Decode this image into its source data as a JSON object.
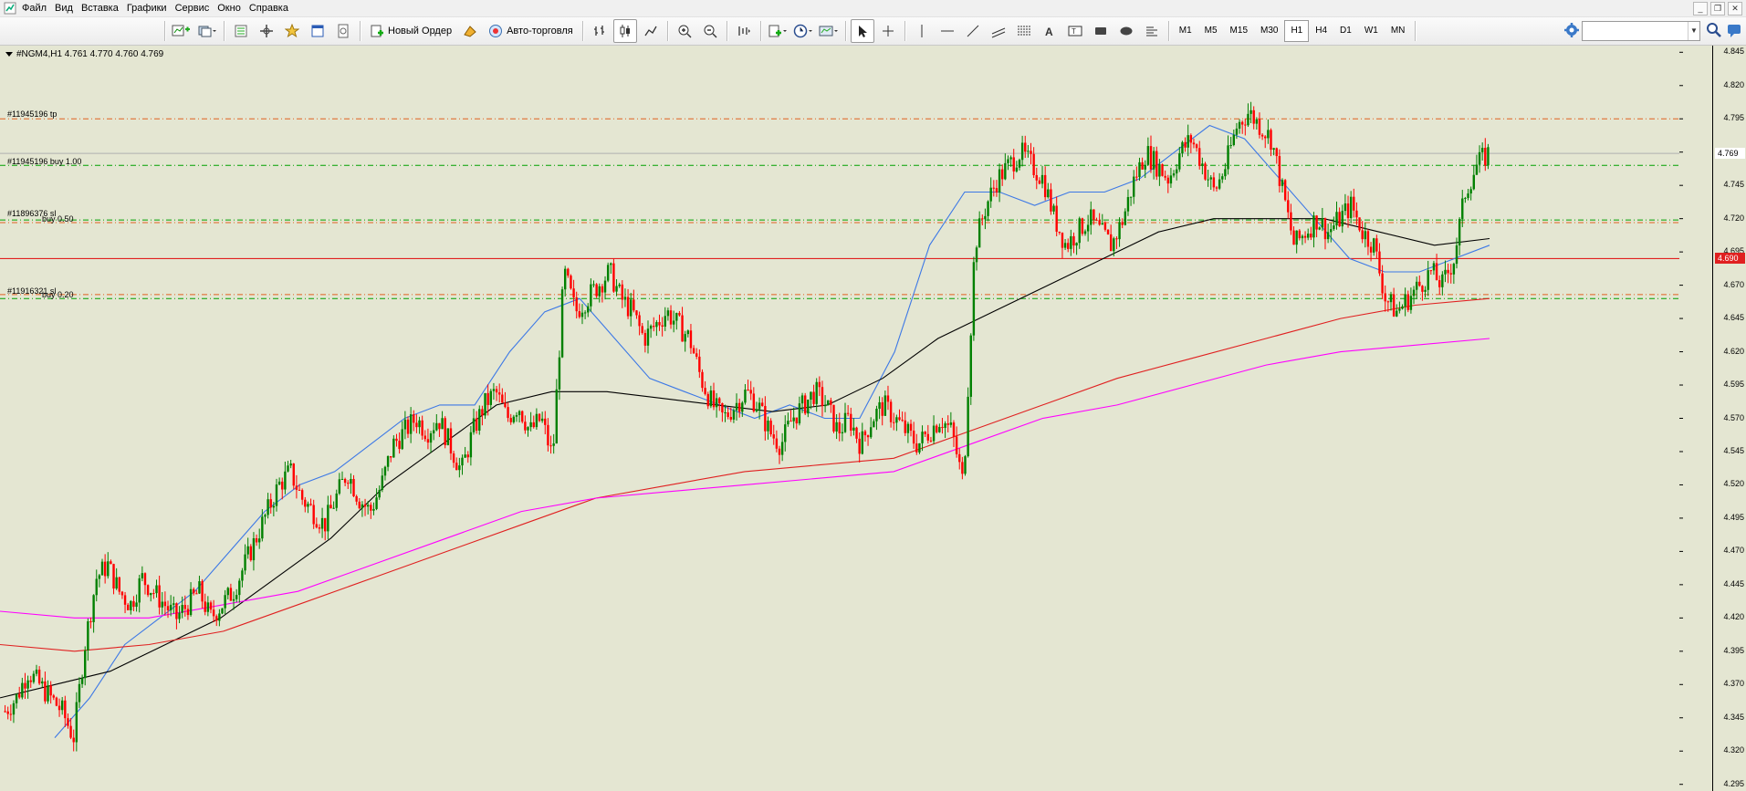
{
  "menu": {
    "items": [
      "Файл",
      "Вид",
      "Вставка",
      "Графики",
      "Сервис",
      "Окно",
      "Справка"
    ]
  },
  "toolbar": {
    "new_order": "Новый Ордер",
    "auto_trading": "Авто-торговля",
    "timeframes": [
      "M1",
      "M5",
      "M15",
      "M30",
      "H1",
      "H4",
      "D1",
      "W1",
      "MN"
    ],
    "active_timeframe": "H1",
    "search_placeholder": ""
  },
  "chart": {
    "header": "#NGM4,H1  4.761 4.770 4.760 4.769",
    "current_price": "4.769",
    "red_line_price": "4.690",
    "colors": {
      "background": "#e4e6d2",
      "bull": "#008000",
      "bear": "#ff0000",
      "ma_blue": "#3c78e6",
      "ma_black": "#000000",
      "ma_red": "#e02020",
      "ma_magenta": "#ff00ff"
    },
    "orders": [
      {
        "label": "#11945196 tp",
        "price": 4.795,
        "color": "#e06020"
      },
      {
        "label": "#11945196 buy 1.00",
        "price": 4.76,
        "color": "#00a000"
      },
      {
        "label": "#11896376 sl",
        "price": 4.717,
        "color": "#e06020"
      },
      {
        "label": "#11916321 sl",
        "price": 4.663,
        "color": "#e06020"
      },
      {
        "label": "buy 0.50",
        "price": 4.719,
        "color": "#00a000"
      },
      {
        "label": "buy 0.20",
        "price": 4.66,
        "color": "#00a000"
      }
    ],
    "price_ticks": [
      "4.845",
      "4.820",
      "4.795",
      "4.770",
      "4.745",
      "4.720",
      "4.695",
      "4.670",
      "4.645",
      "4.620",
      "4.595",
      "4.570",
      "4.545",
      "4.520",
      "4.495",
      "4.470",
      "4.445",
      "4.420",
      "4.395",
      "4.370",
      "4.345",
      "4.320",
      "4.295"
    ]
  },
  "chart_data": {
    "type": "candlestick",
    "symbol": "#NGM4",
    "timeframe": "H1",
    "ylim": [
      4.29,
      4.85
    ],
    "close_path": [
      4.35,
      4.36,
      4.38,
      4.37,
      4.36,
      4.35,
      4.33,
      4.4,
      4.45,
      4.46,
      4.44,
      4.43,
      4.45,
      4.44,
      4.43,
      4.42,
      4.43,
      4.44,
      4.42,
      4.43,
      4.44,
      4.46,
      4.48,
      4.5,
      4.52,
      4.53,
      4.51,
      4.5,
      4.49,
      4.51,
      4.53,
      4.51,
      4.5,
      4.52,
      4.55,
      4.56,
      4.57,
      4.56,
      4.57,
      4.55,
      4.53,
      4.56,
      4.58,
      4.59,
      4.57,
      4.58,
      4.56,
      4.57,
      4.54,
      4.68,
      4.65,
      4.66,
      4.67,
      4.68,
      4.66,
      4.65,
      4.63,
      4.64,
      4.65,
      4.64,
      4.63,
      4.6,
      4.58,
      4.57,
      4.58,
      4.59,
      4.58,
      4.56,
      4.55,
      4.57,
      4.58,
      4.59,
      4.58,
      4.56,
      4.57,
      4.55,
      4.57,
      4.58,
      4.57,
      4.56,
      4.55,
      4.56,
      4.57,
      4.56,
      4.52,
      4.7,
      4.73,
      4.75,
      4.76,
      4.77,
      4.76,
      4.75,
      4.72,
      4.7,
      4.71,
      4.72,
      4.71,
      4.7,
      4.72,
      4.75,
      4.77,
      4.76,
      4.75,
      4.77,
      4.78,
      4.76,
      4.74,
      4.76,
      4.79,
      4.8,
      4.79,
      4.78,
      4.74,
      4.7,
      4.71,
      4.72,
      4.71,
      4.72,
      4.73,
      4.71,
      4.7,
      4.66,
      4.65,
      4.66,
      4.67,
      4.68,
      4.67,
      4.69,
      4.74,
      4.76,
      4.769
    ],
    "moving_averages": [
      {
        "color": "blue",
        "values": [
          4.33,
          4.36,
          4.4,
          4.42,
          4.44,
          4.47,
          4.5,
          4.52,
          4.53,
          4.55,
          4.57,
          4.58,
          4.58,
          4.62,
          4.65,
          4.66,
          4.63,
          4.6,
          4.59,
          4.58,
          4.57,
          4.58,
          4.57,
          4.57,
          4.62,
          4.7,
          4.74,
          4.74,
          4.73,
          4.74,
          4.74,
          4.75,
          4.77,
          4.79,
          4.78,
          4.75,
          4.72,
          4.69,
          4.68,
          4.68,
          4.69,
          4.7
        ]
      },
      {
        "color": "black",
        "values": [
          4.36,
          4.37,
          4.38,
          4.4,
          4.42,
          4.45,
          4.48,
          4.52,
          4.55,
          4.58,
          4.59,
          4.59,
          4.585,
          4.58,
          4.575,
          4.58,
          4.6,
          4.63,
          4.65,
          4.67,
          4.69,
          4.71,
          4.72,
          4.72,
          4.72,
          4.71,
          4.7,
          4.705
        ]
      },
      {
        "color": "red",
        "values": [
          4.4,
          4.395,
          4.4,
          4.41,
          4.43,
          4.45,
          4.47,
          4.49,
          4.51,
          4.52,
          4.53,
          4.535,
          4.54,
          4.56,
          4.58,
          4.6,
          4.615,
          4.63,
          4.645,
          4.655,
          4.66
        ]
      },
      {
        "color": "magenta",
        "values": [
          4.425,
          4.42,
          4.42,
          4.43,
          4.44,
          4.46,
          4.48,
          4.5,
          4.51,
          4.515,
          4.52,
          4.525,
          4.53,
          4.55,
          4.57,
          4.58,
          4.595,
          4.61,
          4.62,
          4.625,
          4.63
        ]
      }
    ]
  }
}
